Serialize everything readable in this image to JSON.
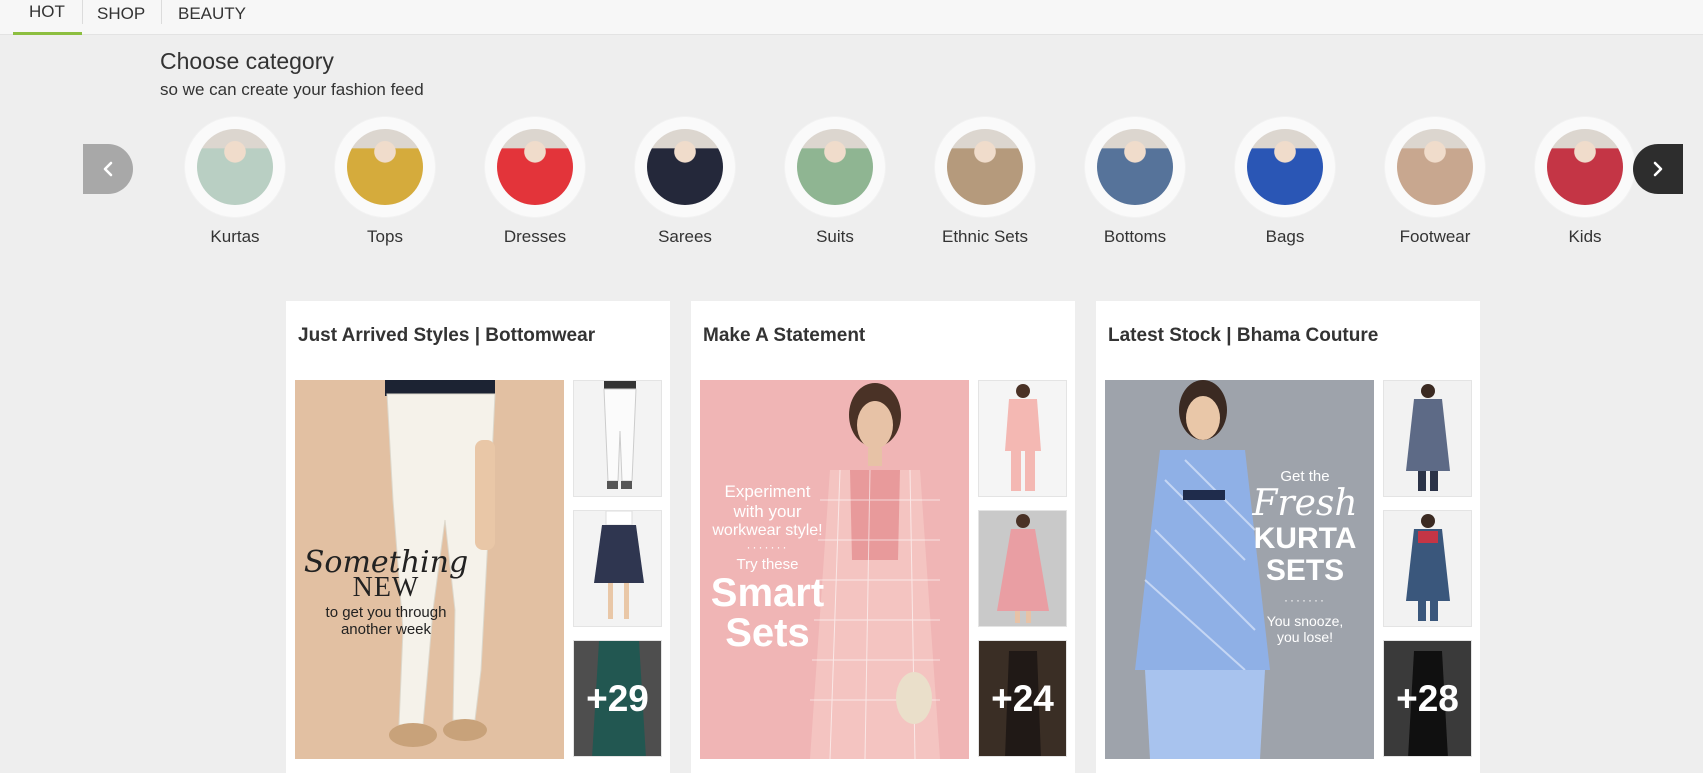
{
  "tabs": [
    {
      "label": "HOT",
      "active": true
    },
    {
      "label": "SHOP",
      "active": false
    },
    {
      "label": "BEAUTY",
      "active": false
    }
  ],
  "categories_section": {
    "heading": "Choose category",
    "subheading": "so we can create your fashion feed",
    "prev_icon": "chevron-left-icon",
    "next_icon": "chevron-right-icon",
    "items": [
      {
        "label": "Kurtas",
        "color": "#b9cfc3"
      },
      {
        "label": "Tops",
        "color": "#d5ab3c"
      },
      {
        "label": "Dresses",
        "color": "#e3343a"
      },
      {
        "label": "Sarees",
        "color": "#24283a"
      },
      {
        "label": "Suits",
        "color": "#8fb592"
      },
      {
        "label": "Ethnic Sets",
        "color": "#b59a7c"
      },
      {
        "label": "Bottoms",
        "color": "#56739a"
      },
      {
        "label": "Bags",
        "color": "#2a56b5"
      },
      {
        "label": "Footwear",
        "color": "#c8a78f"
      },
      {
        "label": "Kids",
        "color": "#c43545"
      }
    ]
  },
  "cards": [
    {
      "title": "Just Arrived Styles | Bottomwear",
      "promo_lines": [
        "Something",
        "NEW",
        "to get you through",
        "another week"
      ],
      "more_count": "+29",
      "main_bg": "#e2c0a2",
      "thumb_colors": [
        "#ececec",
        "#2f3650",
        "#3f9e94"
      ]
    },
    {
      "title": "Make A Statement",
      "promo_lines": [
        "Experiment",
        "with your",
        "workwear style!",
        "Try these",
        "Smart",
        "Sets"
      ],
      "more_count": "+24",
      "main_bg": "#f0b5b5",
      "thumb_colors": [
        "#f4c9c4",
        "#e99ea3",
        "#3b2e28"
      ]
    },
    {
      "title": "Latest Stock | Bhama Couture",
      "promo_lines": [
        "Get the",
        "Fresh",
        "KURTA",
        "SETS",
        "You snooze,",
        "you lose!"
      ],
      "more_count": "+28",
      "main_bg": "#9ea3ab",
      "thumb_colors": [
        "#5d6a86",
        "#3a577c",
        "#1e1e1e"
      ]
    }
  ]
}
